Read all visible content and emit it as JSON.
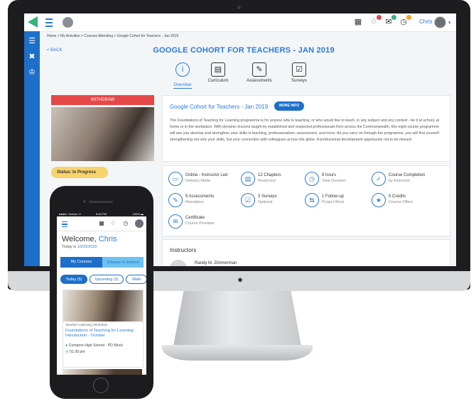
{
  "desktop": {
    "topbar": {
      "user_name": "Chris",
      "caret": "▾",
      "notif_badges": [
        "#e54848",
        "#35b37e",
        "#f5a623"
      ]
    },
    "breadcrumb": "Home > My Activities > Courses Attending > Google Cohort for Teachers - Jan 2019",
    "back_label": "< BACK",
    "page_title": "GOOGLE COHORT FOR TEACHERS - JAN 2019",
    "tabs": [
      {
        "label": "Overview",
        "icon": "info-icon",
        "glyph": "i"
      },
      {
        "label": "Curriculum",
        "icon": "book-icon",
        "glyph": "▤"
      },
      {
        "label": "Assessments",
        "icon": "pencil-note-icon",
        "glyph": "✎"
      },
      {
        "label": "Surveys",
        "icon": "checklist-icon",
        "glyph": "☑"
      }
    ],
    "withdraw_label": "WITHDRAW",
    "status_label": "Status: In Progress",
    "course": {
      "title": "Google Cohort for Teachers - Jan 2019",
      "more_info_label": "MORE INFO",
      "description": "The Foundations of Teaching for Learning programme is for anyone who is teaching, or who would like to teach, in any subject and any context - be it at school, at home or in the workplace. With dynamic lessons taught by established and respected professionals from across the Commonwealth, this eight course programme will see you develop and strengthen your skills in teaching, professionalism, assessment, and more. As you carry on through the programme, you will find yourself strengthening not only your skills, but your connection with colleagues across the globe. A professional development opportunity not to be missed."
    },
    "features": [
      {
        "title": "Online - Instructor Led",
        "sub": "Delivery Mode",
        "glyph": "▭"
      },
      {
        "title": "12 Chapters",
        "sub": "Restricted",
        "glyph": "▤"
      },
      {
        "title": "8 hours",
        "sub": "Total Duration",
        "glyph": "◷"
      },
      {
        "title": "Course Completion",
        "sub": "by Instructor",
        "glyph": "✓"
      },
      {
        "title": "5 Assessments",
        "sub": "Mandatory",
        "glyph": "✎"
      },
      {
        "title": "3 Surveys",
        "sub": "Optional",
        "glyph": "☑"
      },
      {
        "title": "1 Follow-up",
        "sub": "Project Work",
        "glyph": "⇆"
      },
      {
        "title": "5 Credits",
        "sub": "Course Offers",
        "glyph": "★"
      },
      {
        "title": "Certificate",
        "sub": "Course Provides",
        "glyph": "✉"
      }
    ],
    "instructors_heading": "Instructors",
    "instructor_name": "Randy M. Zimmerman"
  },
  "mobile": {
    "status_left": "●●●●○ Verizon ᯤ",
    "status_time": "5:00 PM",
    "status_right": "100% ▬",
    "welcome_prefix": "Welcome, ",
    "welcome_name": "Chris",
    "today_prefix": "Today is ",
    "today_date": "10/23/2018",
    "segments": [
      "My Courses",
      "Classes to Instruct"
    ],
    "pills": [
      "Today (5)",
      "Upcoming (3)",
      "Waiti"
    ],
    "card": {
      "meta": "Teacher Learning (XD3453)",
      "title": "Foundations of Teaching for Learning: Introduction - October",
      "location": "Compton High School - PD Block",
      "time": "01:30 pm"
    }
  }
}
